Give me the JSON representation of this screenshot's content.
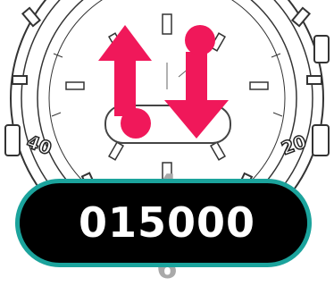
{
  "watch_dial_numbers": {
    "left": "40",
    "right": "20"
  },
  "icon": {
    "name": "sync-arrows-icon",
    "color": "#f0185a"
  },
  "selector": {
    "previous_value": "4",
    "current_value": "015000",
    "next_value": "6"
  },
  "colors": {
    "pill_border": "#1ba39c",
    "pill_background": "#000000",
    "value_text": "#ffffff",
    "roller_digit": "#a9a9a9"
  }
}
